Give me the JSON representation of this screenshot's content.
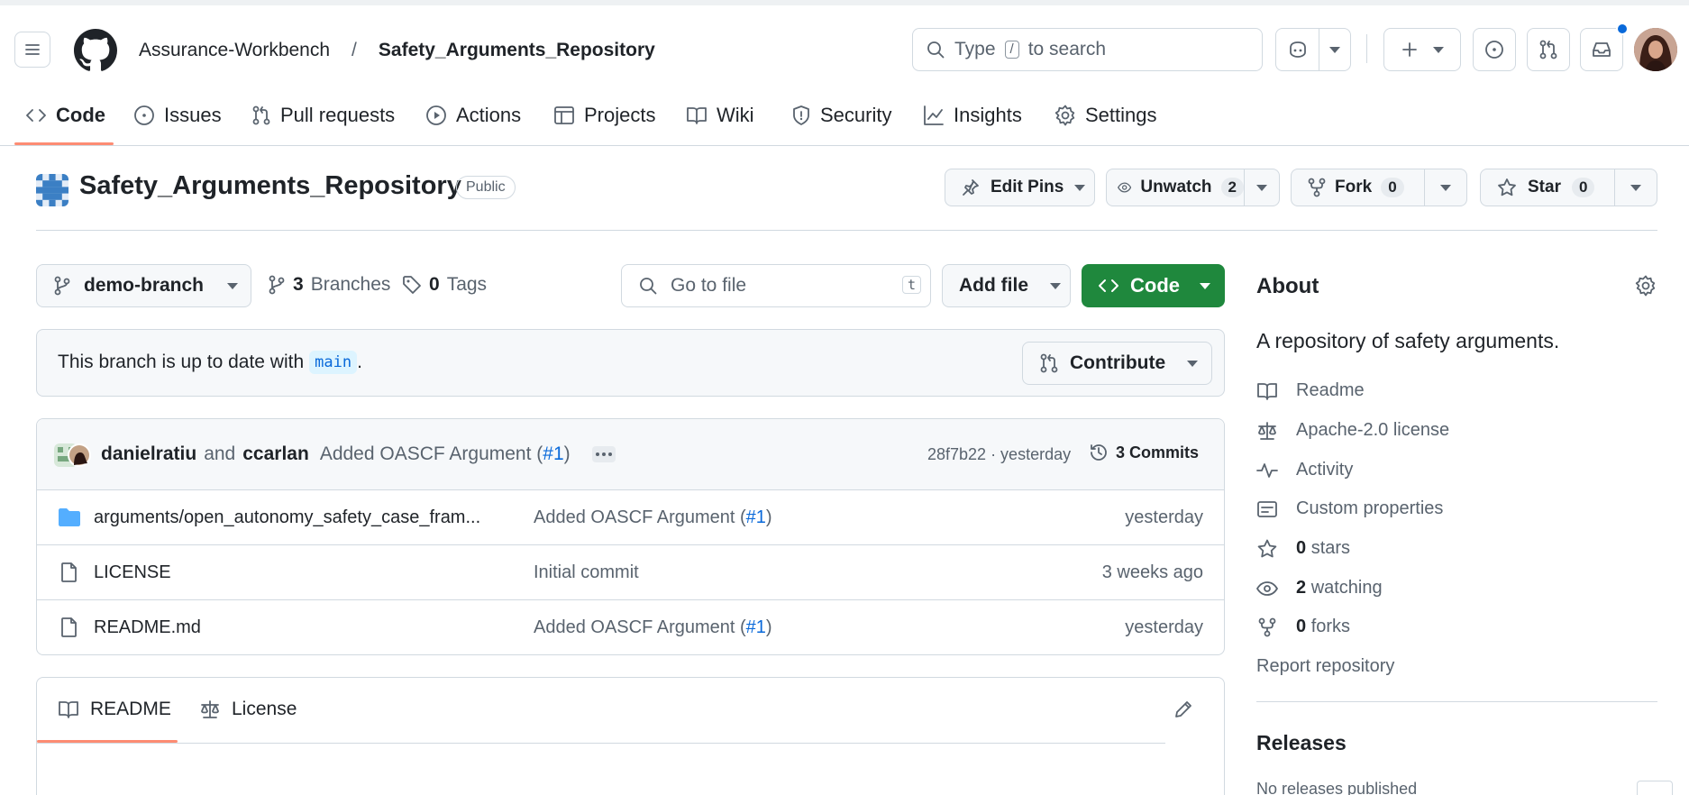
{
  "header": {
    "owner": "Assurance-Workbench",
    "separator": "/",
    "repo": "Safety_Arguments_Repository",
    "search_prefix": "Type",
    "search_key": "/",
    "search_suffix": "to search"
  },
  "tabs": [
    {
      "label": "Code",
      "icon": "code-icon",
      "active": true
    },
    {
      "label": "Issues",
      "icon": "issue-icon"
    },
    {
      "label": "Pull requests",
      "icon": "pull-request-icon"
    },
    {
      "label": "Actions",
      "icon": "play-icon"
    },
    {
      "label": "Projects",
      "icon": "table-icon"
    },
    {
      "label": "Wiki",
      "icon": "book-icon"
    },
    {
      "label": "Security",
      "icon": "shield-icon"
    },
    {
      "label": "Insights",
      "icon": "graph-icon"
    },
    {
      "label": "Settings",
      "icon": "gear-icon"
    }
  ],
  "repo_header": {
    "name": "Safety_Arguments_Repository",
    "visibility": "Public",
    "edit_pins": "Edit Pins",
    "unwatch": "Unwatch",
    "watch_count": "2",
    "fork": "Fork",
    "fork_count": "0",
    "star": "Star",
    "star_count": "0"
  },
  "toolbar": {
    "branch": "demo-branch",
    "branches_count": "3",
    "branches_label": "Branches",
    "tags_count": "0",
    "tags_label": "Tags",
    "goto_placeholder": "Go to file",
    "goto_key": "t",
    "add_file": "Add file",
    "code": "Code"
  },
  "branch_status": {
    "prefix": "This branch is up to date with",
    "branch": "main",
    "suffix": ".",
    "contribute": "Contribute"
  },
  "commit": {
    "author1": "danielratiu",
    "and": "and",
    "author2": "ccarlan",
    "message": "Added OASCF Argument (",
    "pr": "#1",
    "close": ")",
    "hash_time": "28f7b22 · yesterday",
    "commits": "3 Commits"
  },
  "files": [
    {
      "name": "arguments/open_autonomy_safety_case_fram...",
      "type": "folder",
      "msg": "Added OASCF Argument (",
      "pr": "#1",
      "close": ")",
      "time": "yesterday"
    },
    {
      "name": "LICENSE",
      "type": "file",
      "msg": "Initial commit",
      "pr": "",
      "close": "",
      "time": "3 weeks ago"
    },
    {
      "name": "README.md",
      "type": "file",
      "msg": "Added OASCF Argument (",
      "pr": "#1",
      "close": ")",
      "time": "yesterday"
    }
  ],
  "readme_tabs": {
    "readme": "README",
    "license": "License"
  },
  "about": {
    "title": "About",
    "description": "A repository of safety arguments.",
    "readme": "Readme",
    "license": "Apache-2.0 license",
    "activity": "Activity",
    "custom_properties": "Custom properties",
    "stars_count": "0",
    "stars_label": "stars",
    "watching_count": "2",
    "watching_label": "watching",
    "forks_count": "0",
    "forks_label": "forks",
    "report": "Report repository"
  },
  "releases": {
    "title": "Releases",
    "empty": "No releases published"
  },
  "colors": {
    "accent": "#fd8c73",
    "primary_button": "#1f883d",
    "link": "#0969da",
    "notification": "#0969da"
  }
}
